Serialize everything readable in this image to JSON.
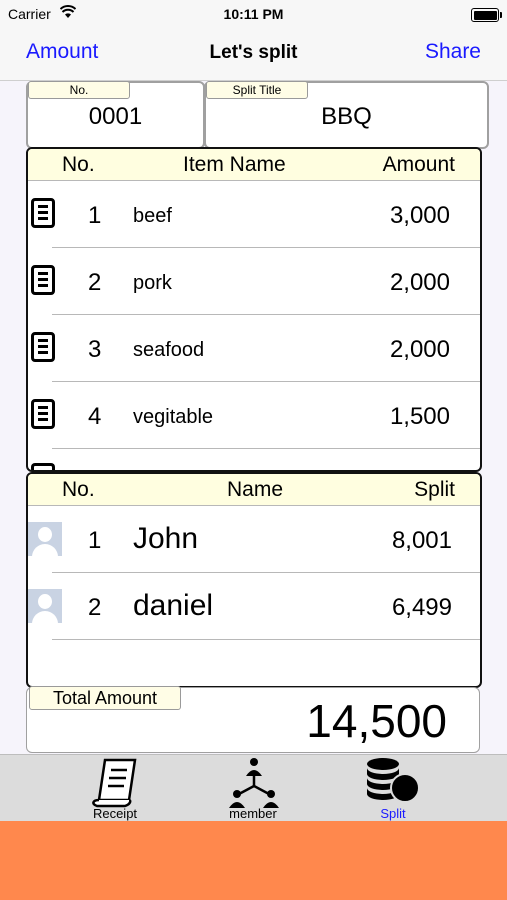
{
  "status_bar": {
    "carrier": "Carrier",
    "time": "10:11 PM"
  },
  "nav": {
    "left": "Amount",
    "title": "Let's split",
    "right": "Share"
  },
  "split_info": {
    "no_label": "No.",
    "no_value": "0001",
    "title_label": "Split Title",
    "title_value": "BBQ"
  },
  "items_table": {
    "headers": {
      "no": "No.",
      "name": "Item Name",
      "amount": "Amount"
    },
    "rows": [
      {
        "no": "1",
        "name": "beef",
        "amount": "3,000"
      },
      {
        "no": "2",
        "name": "pork",
        "amount": "2,000"
      },
      {
        "no": "3",
        "name": "seafood",
        "amount": "2,000"
      },
      {
        "no": "4",
        "name": "vegitable",
        "amount": "1,500"
      }
    ]
  },
  "members_table": {
    "headers": {
      "no": "No.",
      "name": "Name",
      "split": "Split"
    },
    "rows": [
      {
        "no": "1",
        "name": "John",
        "split": "8,001"
      },
      {
        "no": "2",
        "name": "daniel",
        "split": "6,499"
      }
    ]
  },
  "total": {
    "label": "Total Amount",
    "value": "14,500"
  },
  "tabs": [
    {
      "label": "Receipt",
      "icon": "receipt-icon",
      "selected": false
    },
    {
      "label": "member",
      "icon": "member-tree-icon",
      "selected": false
    },
    {
      "label": "Split",
      "icon": "coins-split-icon",
      "selected": true
    }
  ],
  "colors": {
    "accent": "#1a1aff",
    "header_bg": "#fffee0",
    "tab_bar_bg": "#dcdcdc",
    "banner": "#ff884d"
  }
}
